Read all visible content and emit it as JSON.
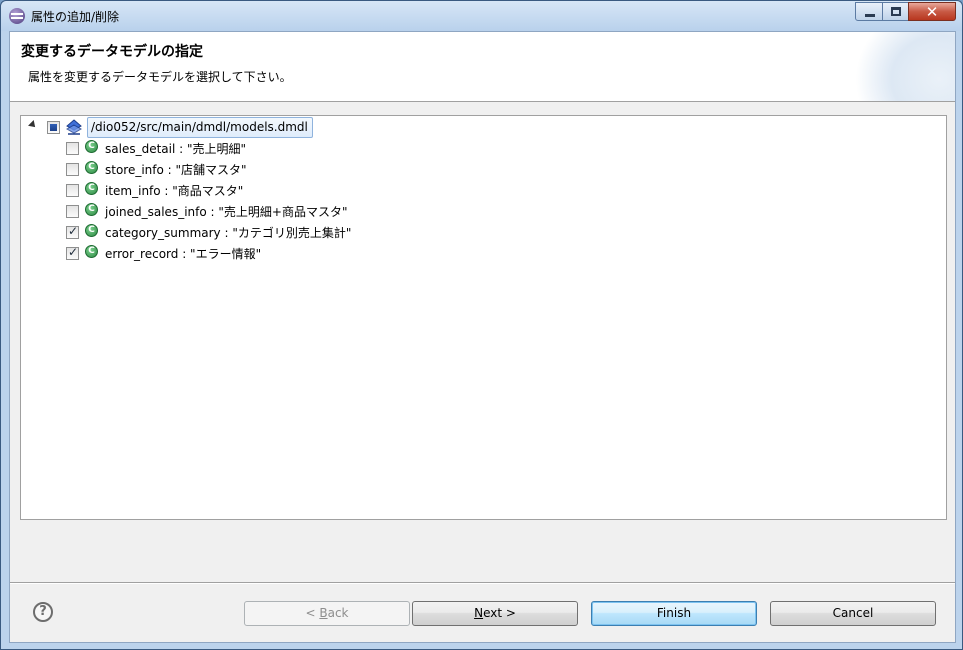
{
  "window": {
    "title": "属性の追加/削除",
    "close_glyph": "✕"
  },
  "banner": {
    "title": "変更するデータモデルの指定",
    "description": "属性を変更するデータモデルを選択して下さい。"
  },
  "tree": {
    "root": {
      "label": "/dio052/src/main/dmdl/models.dmdl",
      "state": "partial",
      "icon": "model-file-icon"
    },
    "items": [
      {
        "label": "sales_detail : \"売上明細\"",
        "checked": false,
        "icon": "class-icon"
      },
      {
        "label": "store_info : \"店舗マスタ\"",
        "checked": false,
        "icon": "class-icon"
      },
      {
        "label": "item_info : \"商品マスタ\"",
        "checked": false,
        "icon": "class-icon"
      },
      {
        "label": "joined_sales_info : \"売上明細+商品マスタ\"",
        "checked": false,
        "icon": "class-icon"
      },
      {
        "label": "category_summary : \"カテゴリ別売上集計\"",
        "checked": true,
        "icon": "class-icon"
      },
      {
        "label": "error_record : \"エラー情報\"",
        "checked": true,
        "icon": "class-icon"
      }
    ]
  },
  "buttons": {
    "help_glyph": "?",
    "back": {
      "prefix": "< ",
      "mnemonic": "B",
      "rest": "ack",
      "enabled": false
    },
    "next": {
      "mnemonic": "N",
      "rest": "ext >",
      "enabled": true
    },
    "finish": {
      "label": "Finish",
      "enabled": true
    },
    "cancel": {
      "label": "Cancel",
      "enabled": true
    }
  },
  "colors": {
    "selection_bg": "#dfecfb",
    "selection_border": "#8fb3dd",
    "class_icon_green": "#2c8a43",
    "checkbox_partial_blue": "#2f5fb7"
  }
}
